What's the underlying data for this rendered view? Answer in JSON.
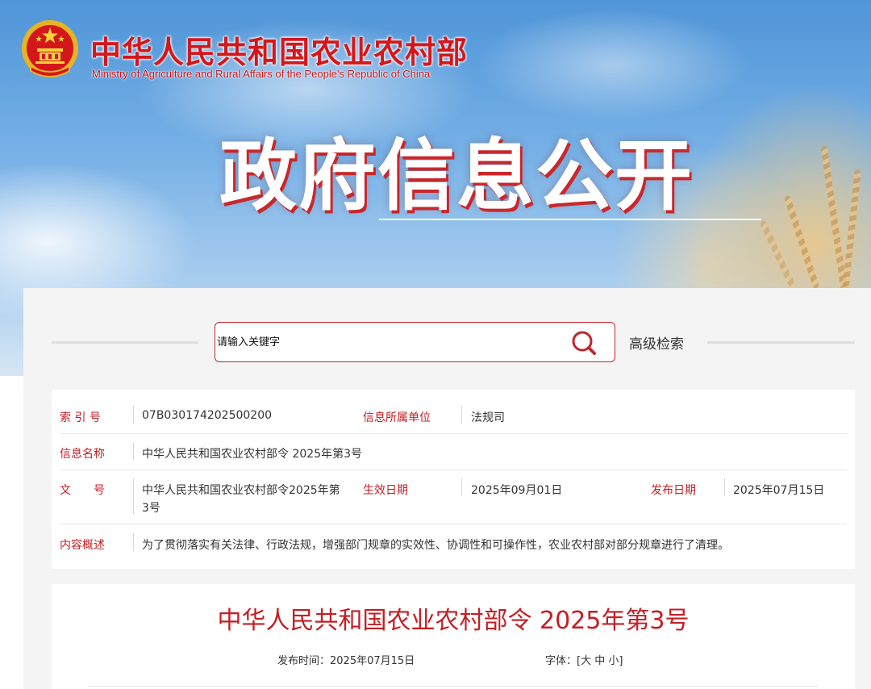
{
  "header": {
    "site_title": "中华人民共和国农业农村部",
    "site_subtitle": "Ministry of Agriculture and Rural Affairs of the People's Republic of China",
    "hero_title": "政府信息公开"
  },
  "search": {
    "placeholder": "请输入关键字",
    "advanced_label": "高级检索"
  },
  "info": {
    "index_label": "索 引 号",
    "index_value": "07B030174202500200",
    "unit_label": "信息所属单位",
    "unit_value": "法规司",
    "name_label": "信息名称",
    "name_value": "中华人民共和国农业农村部令 2025年第3号",
    "doc_label": "文　　号",
    "doc_value_line1": "中华人民共和国农业农村部令2025年第",
    "doc_value_line2": "3号",
    "effective_label": "生效日期",
    "effective_value": "2025年09月01日",
    "publish_label": "发布日期",
    "publish_value": "2025年07月15日",
    "summary_label": "内容概述",
    "summary_value": "为了贯彻落实有关法律、行政法规，增强部门规章的实效性、协调性和可操作性，农业农村部对部分规章进行了清理。"
  },
  "article": {
    "title": "中华人民共和国农业农村部令 2025年第3号",
    "publish_time_label": "发布时间：",
    "publish_time_value": "2025年07月15日",
    "font_label": "字体：",
    "font_open": "[",
    "font_large": "大",
    "font_medium": "中",
    "font_small": "小",
    "font_close": "]"
  },
  "colors": {
    "accent_red": "#c41e24",
    "title_red": "#d4171b",
    "panel_bg": "#f4f4f4"
  },
  "icons": {
    "search": "search-icon",
    "emblem": "national-emblem-icon"
  }
}
